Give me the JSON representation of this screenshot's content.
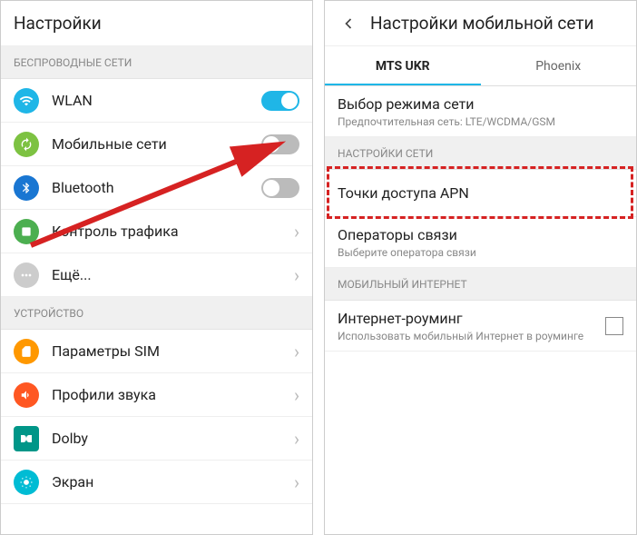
{
  "left": {
    "title": "Настройки",
    "sections": {
      "wireless_header": "БЕСПРОВОДНЫЕ СЕТИ",
      "device_header": "УСТРОЙСТВО"
    },
    "items": {
      "wlan": "WLAN",
      "mobile": "Мобильные сети",
      "bluetooth": "Bluetooth",
      "traffic": "Контроль трафика",
      "more": "Ещё...",
      "sim": "Параметры SIM",
      "sound": "Профили звука",
      "dolby": "Dolby",
      "display": "Экран"
    }
  },
  "right": {
    "title": "Настройки мобильной сети",
    "tabs": {
      "mts": "MTS UKR",
      "phoenix": "Phoenix"
    },
    "network_mode": {
      "title": "Выбор режима сети",
      "sub": "Предпочтительная сеть: LTE/WCDMA/GSM"
    },
    "network_settings_header": "НАСТРОЙКИ СЕТИ",
    "apn": "Точки доступа APN",
    "operators": {
      "title": "Операторы связи",
      "sub": "Выберите оператора связи"
    },
    "mobile_internet_header": "МОБИЛЬНЫЙ ИНТЕРНЕТ",
    "roaming": {
      "title": "Интернет-роуминг",
      "sub": "Использовать мобильный Интернет в роуминге"
    }
  },
  "colors": {
    "wlan": "#1fb6e7",
    "mobile": "#7dc242",
    "bluetooth": "#1976d2",
    "traffic": "#4caf50",
    "more": "#ccc",
    "sim": "#ff9800",
    "sound": "#ff5722",
    "dolby": "#009688",
    "display": "#00bcd4"
  }
}
